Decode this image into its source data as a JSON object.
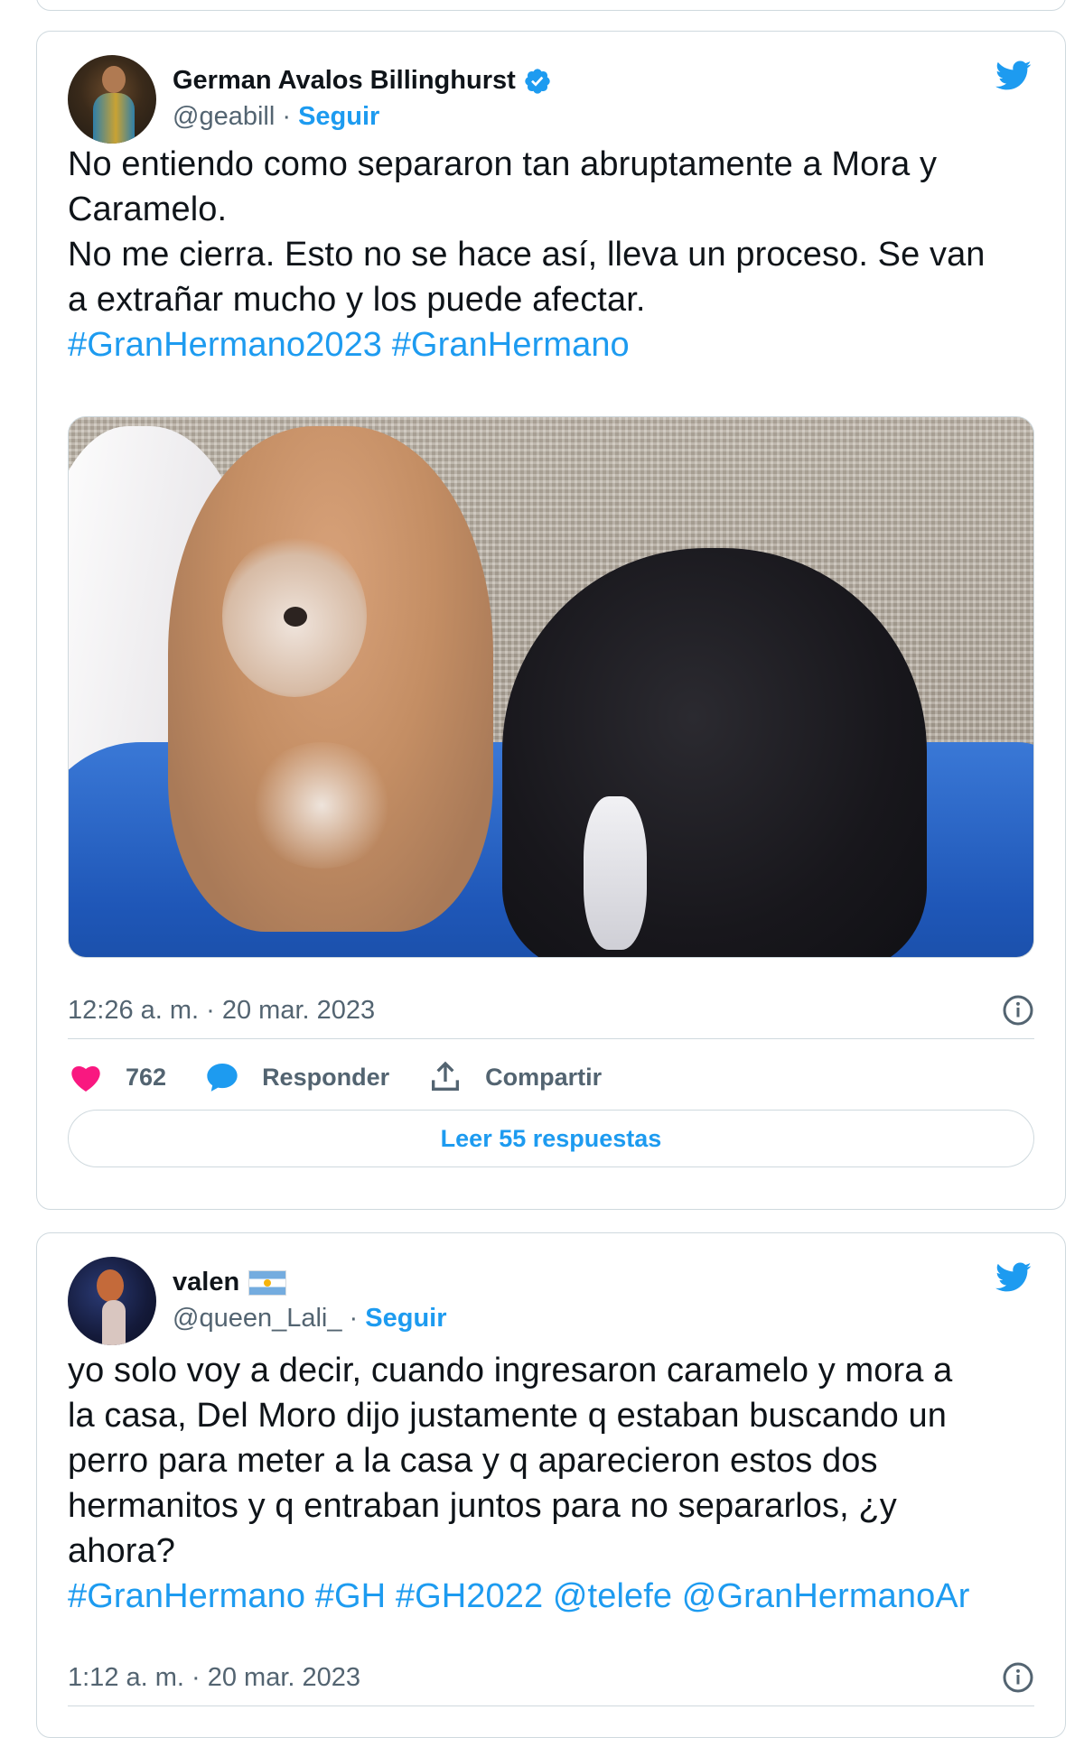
{
  "tweet1": {
    "author_name": "German Avalos Billinghurst",
    "handle": "@geabill",
    "separator": " · ",
    "follow_label": "Seguir",
    "text_lines": [
      "No entiendo como separaron tan abruptamente a Mora y",
      "Caramelo.",
      "No me cierra. Esto no se hace así, lleva un proceso. Se van",
      "a extrañar mucho y los puede afectar."
    ],
    "hashtags": "#GranHermano2023 #GranHermano",
    "timestamp": "12:26 a. m. · 20 mar. 2023",
    "likes": "762",
    "reply_label": "Responder",
    "share_label": "Compartir",
    "read_replies_label": "Leer 55 respuestas"
  },
  "tweet2": {
    "author_name": "valen",
    "handle": "@queen_Lali_",
    "separator": " · ",
    "follow_label": "Seguir",
    "text_lines": [
      "yo solo voy a decir, cuando ingresaron caramelo y mora a",
      "la casa, Del Moro dijo justamente q estaban buscando un",
      "perro para meter a la casa y q aparecieron estos dos",
      "hermanitos y q entraban juntos para no separarlos, ¿y",
      "ahora?"
    ],
    "hashtags": "#GranHermano #GH #GH2022 @telefe @GranHermanoAr",
    "timestamp": "1:12 a. m. · 20 mar. 2023"
  },
  "colors": {
    "accent": "#1d9bf0",
    "like": "#f91880",
    "muted": "#536471",
    "border": "#cfd9de"
  },
  "icons": [
    "verified-badge-icon",
    "twitter-bird-icon",
    "heart-icon",
    "reply-bubble-icon",
    "share-icon",
    "info-icon",
    "argentina-flag-icon"
  ]
}
